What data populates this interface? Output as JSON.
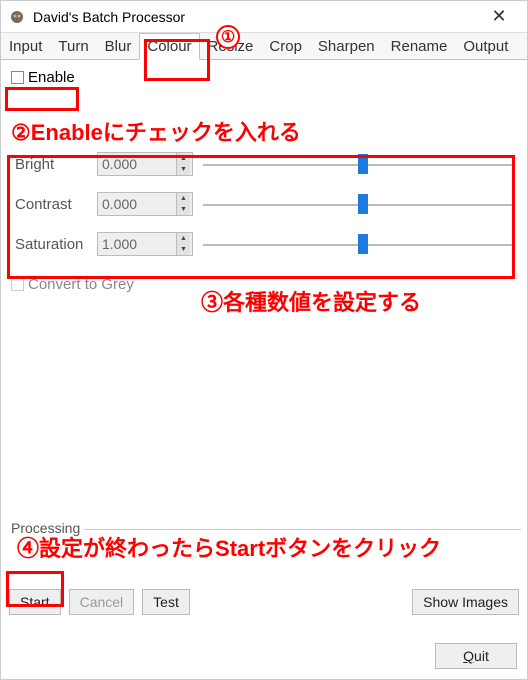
{
  "window": {
    "title": "David's Batch Processor",
    "close": "✕"
  },
  "tabs": [
    "Input",
    "Turn",
    "Blur",
    "Colour",
    "Resize",
    "Crop",
    "Sharpen",
    "Rename",
    "Output"
  ],
  "active_tab_index": 3,
  "enable_label": "Enable",
  "params": {
    "bright": {
      "label": "Bright",
      "value": "0.000",
      "slider_pos": 0.5
    },
    "contrast": {
      "label": "Contrast",
      "value": "0.000",
      "slider_pos": 0.5
    },
    "saturation": {
      "label": "Saturation",
      "value": "1.000",
      "slider_pos": 0.5
    }
  },
  "convert_label": "Convert to Grey",
  "processing": {
    "group_label": "Processing",
    "start": "Start",
    "cancel": "Cancel",
    "test": "Test",
    "show_images": "Show Images"
  },
  "quit_label": "Quit",
  "annotations": {
    "n1": "①",
    "n2_prefix": "②",
    "n2_text": "Enableにチェックを入れる",
    "n3_prefix": "③",
    "n3_text": "各種数値を設定する",
    "n4_prefix": "④",
    "n4_text": "設定が終わったらStartボタンをクリック"
  }
}
